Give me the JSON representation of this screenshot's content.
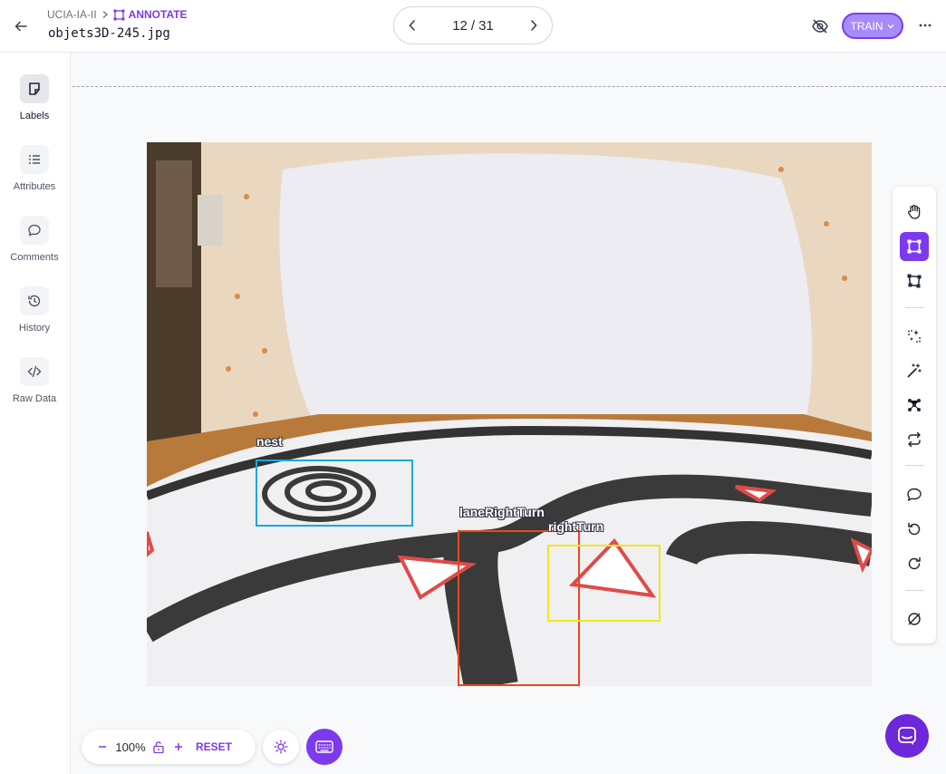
{
  "header": {
    "workspace": "UCIA-IA-II",
    "mode_label": "ANNOTATE",
    "filename": "objets3D-245.jpg",
    "pager": {
      "current": "12",
      "separator": "/",
      "total": "31"
    },
    "train_label": "TRAIN"
  },
  "sidebar": {
    "items": [
      {
        "label": "Labels",
        "icon": "sticky-note-icon",
        "active": true
      },
      {
        "label": "Attributes",
        "icon": "list-icon",
        "active": false
      },
      {
        "label": "Comments",
        "icon": "comment-icon",
        "active": false
      },
      {
        "label": "History",
        "icon": "history-icon",
        "active": false
      },
      {
        "label": "Raw Data",
        "icon": "code-icon",
        "active": false
      }
    ]
  },
  "annotations": [
    {
      "label": "nest",
      "color": "#1ca7e0"
    },
    {
      "label": "laneRightTurn",
      "color": "#e8491d"
    },
    {
      "label": "rightTurn",
      "color": "#f2e619"
    }
  ],
  "tools": [
    {
      "name": "pan-tool",
      "icon": "hand-icon",
      "active": false
    },
    {
      "name": "bbox-tool",
      "icon": "bounding-box-icon",
      "active": true
    },
    {
      "name": "polygon-tool",
      "icon": "polygon-icon",
      "active": false
    },
    {
      "name": "smart-select-tool",
      "icon": "sparkle-select-icon",
      "active": false
    },
    {
      "name": "magic-wand-tool",
      "icon": "magic-wand-icon",
      "active": false
    },
    {
      "name": "keypoint-tool",
      "icon": "keypoints-icon",
      "active": false
    },
    {
      "name": "repeat-tool",
      "icon": "repeat-icon",
      "active": false
    },
    {
      "name": "comment-tool",
      "icon": "comment-icon",
      "active": false
    },
    {
      "name": "undo-tool",
      "icon": "undo-icon",
      "active": false
    },
    {
      "name": "redo-tool",
      "icon": "redo-icon",
      "active": false
    },
    {
      "name": "null-tool",
      "icon": "null-icon",
      "active": false
    }
  ],
  "zoom": {
    "value": "100%",
    "reset_label": "RESET"
  },
  "colors": {
    "accent": "#7c3aed",
    "accent_light": "#a78bfa"
  }
}
